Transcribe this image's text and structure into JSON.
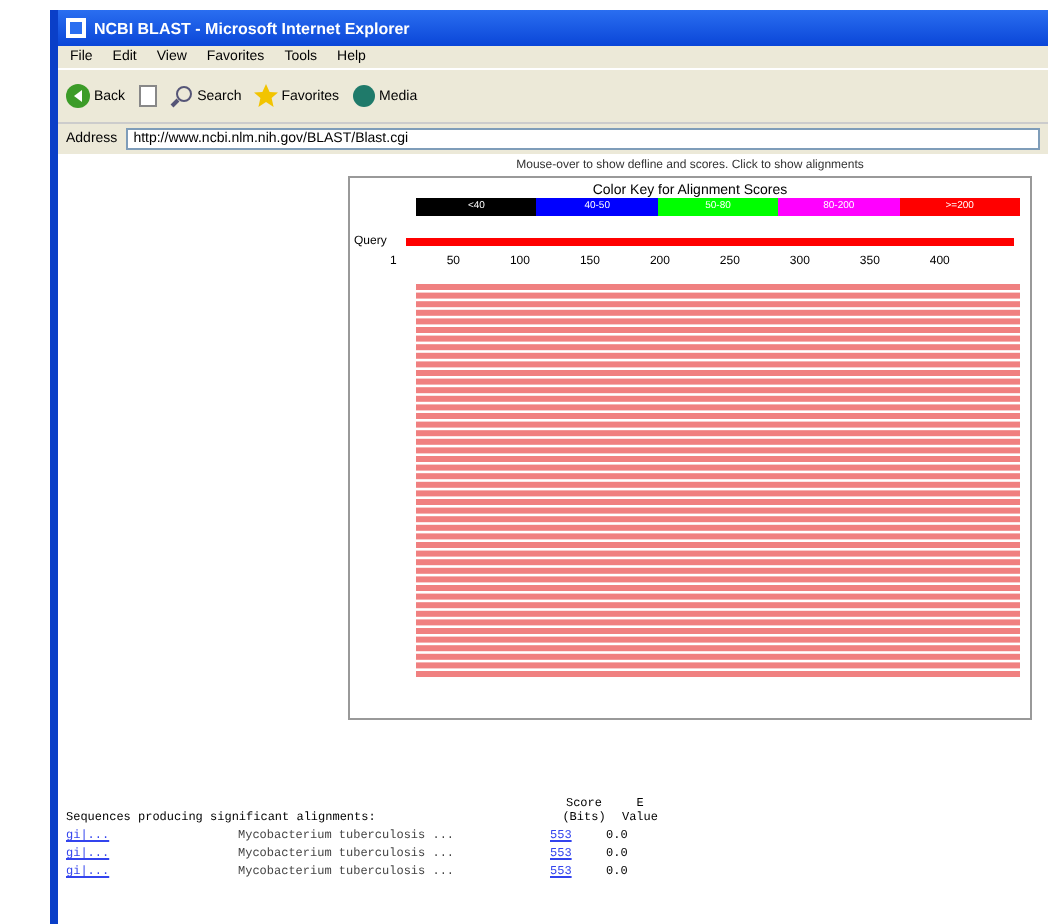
{
  "window": {
    "title": "NCBI BLAST - Microsoft Internet Explorer"
  },
  "menu": [
    "File",
    "Edit",
    "View",
    "Favorites",
    "Tools",
    "Help"
  ],
  "toolbar": [
    {
      "kind": "back",
      "label": "Back"
    },
    {
      "kind": "stop"
    },
    {
      "kind": "search",
      "label": "Search"
    },
    {
      "kind": "favorites",
      "label": "Favorites"
    },
    {
      "kind": "media",
      "label": "Media"
    }
  ],
  "address": {
    "label": "Address",
    "value": "http://www.ncbi.nlm.nih.gov/BLAST/Blast.cgi"
  },
  "chart": {
    "caption": "Mouse-over to show defline and scores. Click to show alignments",
    "legend_title": "Color Key for Alignment Scores",
    "legend": [
      {
        "label": "<40",
        "color": "#000000"
      },
      {
        "label": "40-50",
        "color": "#0000ff"
      },
      {
        "label": "50-80",
        "color": "#00ff00"
      },
      {
        "label": "80-200",
        "color": "#ff00ff"
      },
      {
        "label": ">=200",
        "color": "#ff0000"
      }
    ],
    "query_label": "Query",
    "ticks": [
      "1",
      "50",
      "100",
      "150",
      "200",
      "250",
      "300",
      "350",
      "400"
    ]
  },
  "results": {
    "heading": "Sequences producing significant alignments:",
    "columns": [
      [
        "Score",
        "(Bits)"
      ],
      [
        "E",
        "Value"
      ]
    ],
    "rows": [
      {
        "id": "gi|...",
        "description": "Mycobacterium tuberculosis ...",
        "score": "553",
        "evalue": "0.0"
      },
      {
        "id": "gi|...",
        "description": "Mycobacterium tuberculosis ...",
        "score": "553",
        "evalue": "0.0"
      },
      {
        "id": "gi|...",
        "description": "Mycobacterium tuberculosis ...",
        "score": "553",
        "evalue": "0.0"
      }
    ]
  }
}
